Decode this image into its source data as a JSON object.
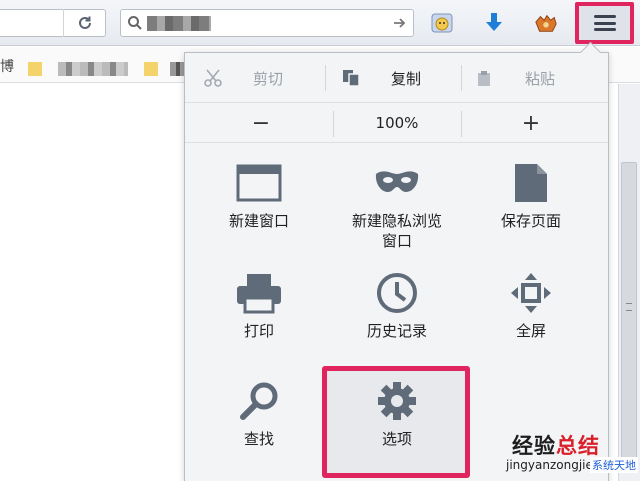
{
  "toolbar": {
    "search_text": "",
    "icons": [
      "reload-icon",
      "search-icon",
      "go-arrow-icon",
      "addon-icon",
      "download-arrow-icon",
      "addon-paw-icon",
      "hamburger-menu-icon"
    ]
  },
  "bookmarks": {
    "first_char": "博"
  },
  "menu": {
    "edit": {
      "cut": "剪切",
      "copy": "复制",
      "paste": "粘贴"
    },
    "zoom": {
      "minus": "−",
      "value": "100%",
      "plus": "+"
    },
    "items": {
      "new_window": "新建窗口",
      "new_private_window": "新建隐私浏览\n窗口",
      "save_page": "保存页面",
      "print": "打印",
      "history": "历史记录",
      "fullscreen": "全屏",
      "find": "查找",
      "options": "选项"
    }
  },
  "watermark": {
    "title_a": "经验",
    "title_b": "总结",
    "url": "jingyanzongjie.com",
    "badge": "系统天地"
  },
  "colors": {
    "highlight": "#e0245e",
    "icon_gray": "#5f6b78",
    "download_blue": "#1e7fd8"
  }
}
